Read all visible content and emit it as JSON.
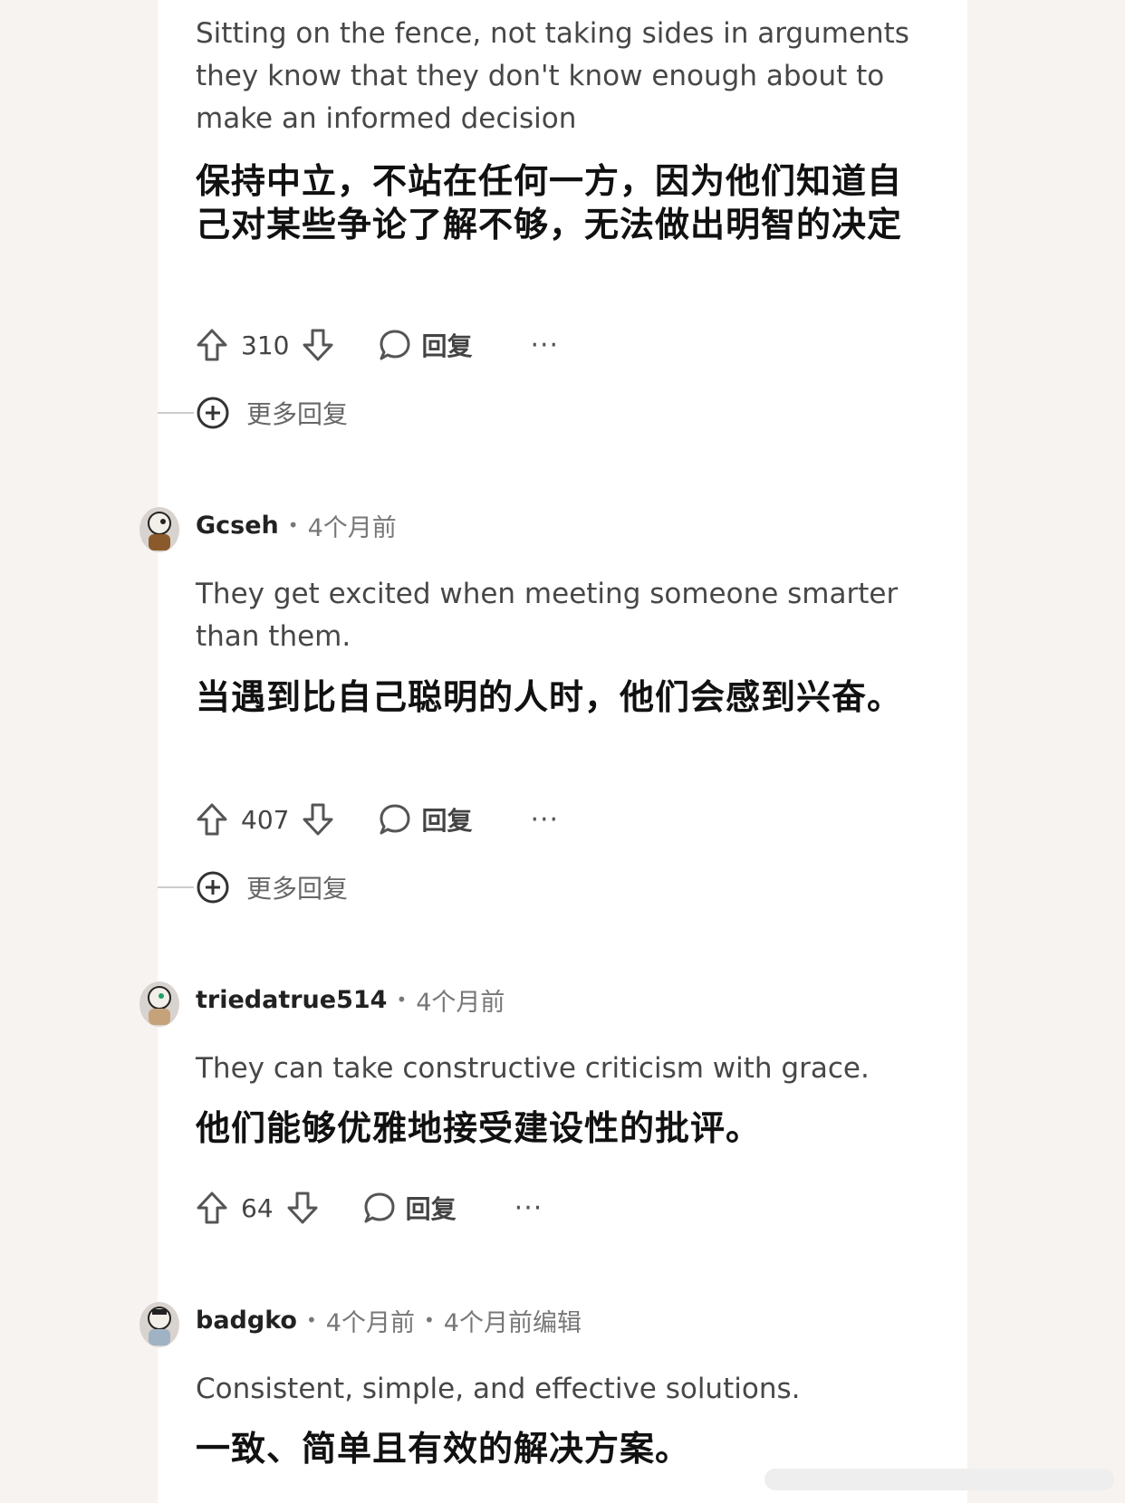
{
  "comments": [
    {
      "text_en": "Sitting on the fence, not taking sides in arguments they know that they don't know enough about to make an informed decision",
      "text_zh": "保持中立，不站在任何一方，因为他们知道自己对某些争论了解不够，无法做出明智的决定",
      "votes": "310",
      "reply_label": "回复",
      "more_icon": "···",
      "more_replies_label": "更多回复"
    },
    {
      "author": "Gcseh",
      "time": "4个月前",
      "text_en": "They get excited when meeting someone smarter than them.",
      "text_zh": "当遇到比自己聪明的人时，他们会感到兴奋。",
      "votes": "407",
      "reply_label": "回复",
      "more_icon": "···",
      "more_replies_label": "更多回复"
    },
    {
      "author": "triedatrue514",
      "time": "4个月前",
      "text_en": "They can take constructive criticism with grace.",
      "text_zh": "他们能够优雅地接受建设性的批评。",
      "votes": "64",
      "reply_label": "回复",
      "more_icon": "···"
    },
    {
      "author": "badgko",
      "time": "4个月前",
      "edited": "4个月前编辑",
      "text_en": "Consistent, simple, and effective solutions.",
      "text_zh": "一致、简单且有效的解决方案。"
    }
  ],
  "separator": "•",
  "icons": [
    "upvote-icon",
    "downvote-icon",
    "comment-bubble-icon",
    "more-options-icon",
    "expand-plus-icon"
  ]
}
